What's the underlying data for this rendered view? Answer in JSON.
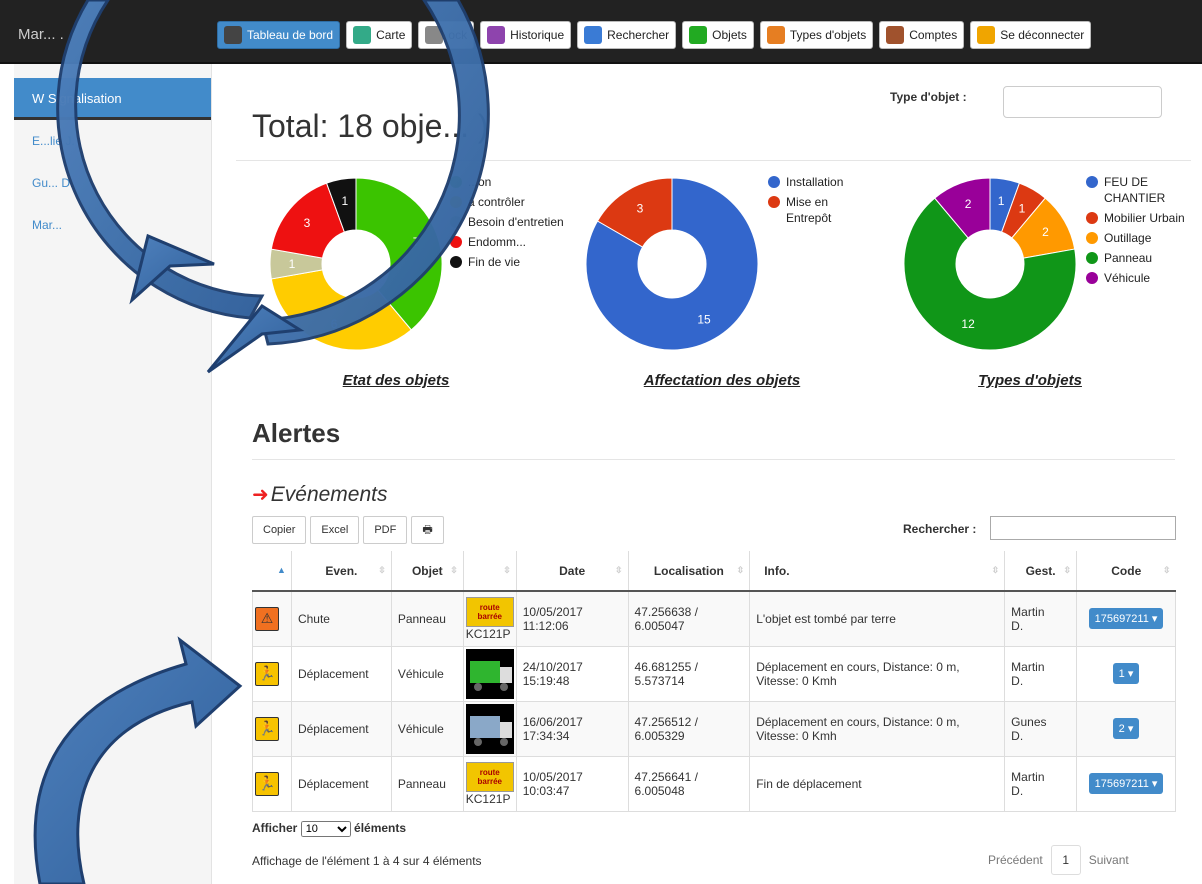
{
  "topbar": {
    "brand": "Mar... .",
    "nav": [
      {
        "label": "Tableau de bord",
        "icon": "dashboard-icon",
        "color": "#444"
      },
      {
        "label": "Carte",
        "icon": "map-icon",
        "color": "#3a8"
      },
      {
        "label": "ock",
        "icon": "stock-icon",
        "color": "#888"
      },
      {
        "label": "Historique",
        "icon": "history-icon",
        "color": "#8e44ad"
      },
      {
        "label": "Rechercher",
        "icon": "search-icon",
        "color": "#3a7bd5"
      },
      {
        "label": "Objets",
        "icon": "objects-icon",
        "color": "#2a2"
      },
      {
        "label": "Types d'objets",
        "icon": "types-icon",
        "color": "#e67e22"
      },
      {
        "label": "Comptes",
        "icon": "accounts-icon",
        "color": "#a0522d"
      },
      {
        "label": "Se déconnecter",
        "icon": "power-icon",
        "color": "#f0a500"
      }
    ]
  },
  "sidebar": {
    "active": "W Signalisation",
    "items": [
      "E...lie J.",
      "Gu... D.",
      "Mar..."
    ]
  },
  "dashboard": {
    "total": "Total: 18 obje... )",
    "type_filter_label": "Type d'objet :"
  },
  "charts": {
    "etat": {
      "title": "Etat des objets"
    },
    "affectation": {
      "title": "Affectation des objets"
    },
    "types": {
      "title": "Types d'objets"
    }
  },
  "chart_data": [
    {
      "type": "pie",
      "title": "Etat des objets",
      "categories": [
        "Bon",
        "à contrôler",
        "Besoin d'entretien",
        "Endomm...",
        "Fin de vie"
      ],
      "legend_labels": [
        "...on",
        "à contrôler",
        "Besoin d'entretien",
        "Endomm...",
        "Fin de vie"
      ],
      "values": [
        7,
        6,
        1,
        3,
        1
      ],
      "colors": [
        "#3bc400",
        "#ffcc00",
        "#c8c89a",
        "#ee1111",
        "#111111"
      ]
    },
    {
      "type": "pie",
      "title": "Affectation des objets",
      "categories": [
        "Installation",
        "Mise en Entrepôt"
      ],
      "values": [
        15,
        3
      ],
      "colors": [
        "#3366cc",
        "#dc3912"
      ]
    },
    {
      "type": "pie",
      "title": "Types d'objets",
      "categories": [
        "FEU DE CHANTIER",
        "Mobilier Urbain",
        "Outillage",
        "Panneau",
        "Véhicule"
      ],
      "values": [
        1,
        1,
        2,
        12,
        2
      ],
      "colors": [
        "#3366cc",
        "#dc3912",
        "#ff9900",
        "#109618",
        "#990099"
      ]
    }
  ],
  "alerts": {
    "heading": "Alertes",
    "events_heading": "Evénements",
    "buttons": [
      "Copier",
      "Excel",
      "PDF",
      "🖶"
    ],
    "search_label": "Rechercher :",
    "columns": [
      "",
      "Even.",
      "Objet",
      "",
      "Date",
      "Localisation",
      "Info.",
      "Gest.",
      "Code"
    ],
    "rows": [
      {
        "event": "Chute",
        "icon": "fall-icon",
        "object": "Panneau",
        "thumb": "sign",
        "thumb_caption": "KC121P",
        "date": "10/05/2017",
        "time": "11:12:06",
        "lat": "47.256638 /",
        "lon": "6.005047",
        "info": "L'objet est tombé par terre",
        "manager": "Martin",
        "manager2": "D.",
        "code": "175697211 ▾"
      },
      {
        "event": "Déplacement",
        "icon": "running-icon",
        "object": "Véhicule",
        "thumb": "truck-green",
        "thumb_caption": "",
        "date": "24/10/2017",
        "time": "15:19:48",
        "lat": "46.681255 /",
        "lon": "5.573714",
        "info": "Déplacement en cours, Distance: 0 m, Vitesse: 0 Kmh",
        "manager": "Martin",
        "manager2": "D.",
        "code": "1 ▾"
      },
      {
        "event": "Déplacement",
        "icon": "running-icon",
        "object": "Véhicule",
        "thumb": "truck-blue",
        "thumb_caption": "",
        "date": "16/06/2017",
        "time": "17:34:34",
        "lat": "47.256512 /",
        "lon": "6.005329",
        "info": "Déplacement en cours, Distance: 0 m, Vitesse: 0 Kmh",
        "manager": "Gunes",
        "manager2": "D.",
        "code": "2 ▾"
      },
      {
        "event": "Déplacement",
        "icon": "running-icon",
        "object": "Panneau",
        "thumb": "sign",
        "thumb_caption": "KC121P",
        "date": "10/05/2017",
        "time": "10:03:47",
        "lat": "47.256641 /",
        "lon": "6.005048",
        "info": "Fin de déplacement",
        "manager": "Martin",
        "manager2": "D.",
        "code": "175697211 ▾"
      }
    ],
    "sign_text": [
      "route",
      "barrée"
    ],
    "show_label": "Afficher",
    "show_value": "10",
    "show_suffix": "éléments",
    "info": "Affichage de l'élément 1 à 4 sur 4 éléments",
    "prev": "Précédent",
    "page": "1",
    "next": "Suivant"
  }
}
